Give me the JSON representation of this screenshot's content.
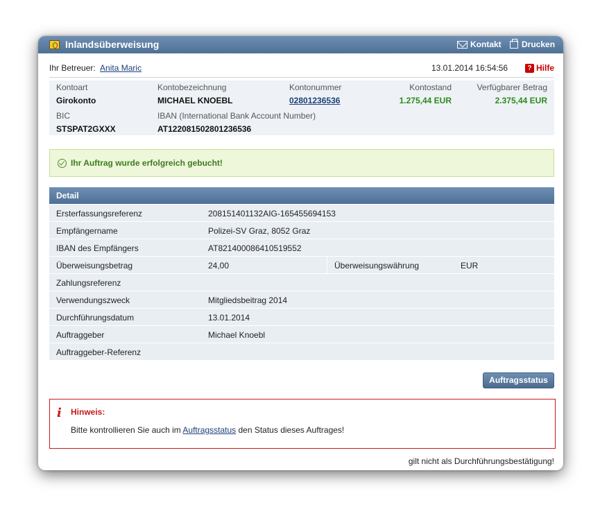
{
  "window": {
    "title": "Inlandsüberweisung",
    "contact_label": "Kontakt",
    "print_label": "Drucken"
  },
  "advisor": {
    "label": "Ihr Betreuer:",
    "name": "Anita Maric",
    "datetime": "13.01.2014 16:54:56",
    "help_label": "Hilfe"
  },
  "account": {
    "type_label": "Kontoart",
    "type_value": "Girokonto",
    "name_label": "Kontobezeichnung",
    "name_value": "MICHAEL KNOEBL",
    "number_label": "Kontonummer",
    "number_value": "02801236536",
    "balance_label": "Kontostand",
    "balance_value": "1.275,44 EUR",
    "available_label": "Verfügbarer Betrag",
    "available_value": "2.375,44 EUR",
    "bic_label": "BIC",
    "bic_value": "STSPAT2GXXX",
    "iban_label": "IBAN (International Bank Account Number)",
    "iban_value": "AT122081502801236536"
  },
  "success_message": "Ihr Auftrag wurde erfolgreich gebucht!",
  "detail": {
    "header": "Detail",
    "rows": [
      {
        "label": "Ersterfassungsreferenz",
        "value": "208151401132AIG-165455694153"
      },
      {
        "label": "Empfängername",
        "value": "Polizei-SV Graz, 8052 Graz"
      },
      {
        "label": "IBAN des Empfängers",
        "value": "AT821400086410519552"
      },
      {
        "label": "Überweisungsbetrag",
        "value": "24,00",
        "label2": "Überweisungswährung",
        "value2": "EUR"
      },
      {
        "label": "Zahlungsreferenz",
        "value": ""
      },
      {
        "label": "Verwendungszweck",
        "value": "Mitgliedsbeitrag 2014"
      },
      {
        "label": "Durchführungsdatum",
        "value": "13.01.2014"
      },
      {
        "label": "Auftraggeber",
        "value": "Michael Knoebl"
      },
      {
        "label": "Auftraggeber-Referenz",
        "value": ""
      }
    ]
  },
  "status_button_label": "Auftragsstatus",
  "notice": {
    "title": "Hinweis:",
    "text_before": "Bitte kontrollieren Sie auch im",
    "link": "Auftragsstatus",
    "text_after": "den Status dieses Auftrages!"
  },
  "footer_note": "gilt nicht als Durchführungsbestätigung!",
  "colors": {
    "header_blue": "#5a7ba0",
    "success_bg": "#eef7d9",
    "success_text": "#3d7b22",
    "notice_red": "#c51a1a",
    "amount_green": "#2b8a1e"
  }
}
